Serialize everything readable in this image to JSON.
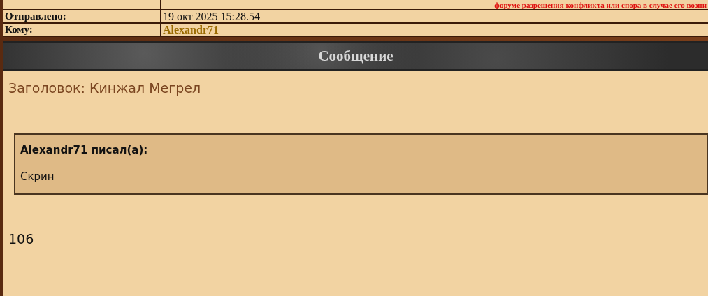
{
  "notice": "форуме разрешения конфликта или спора в случае его возни",
  "details": [
    {
      "label": "Отправлено:",
      "value": "19 окт 2025 15:28.54",
      "kind": "text"
    },
    {
      "label": "Кому:",
      "value": "Alexandr71",
      "kind": "user"
    }
  ],
  "message": {
    "header": "Сообщение",
    "subject": "Заголовок: Кинжал Мегрел",
    "quote": {
      "author": "Alexandr71 писал(а):",
      "text": "Скрин"
    },
    "body": "106"
  }
}
